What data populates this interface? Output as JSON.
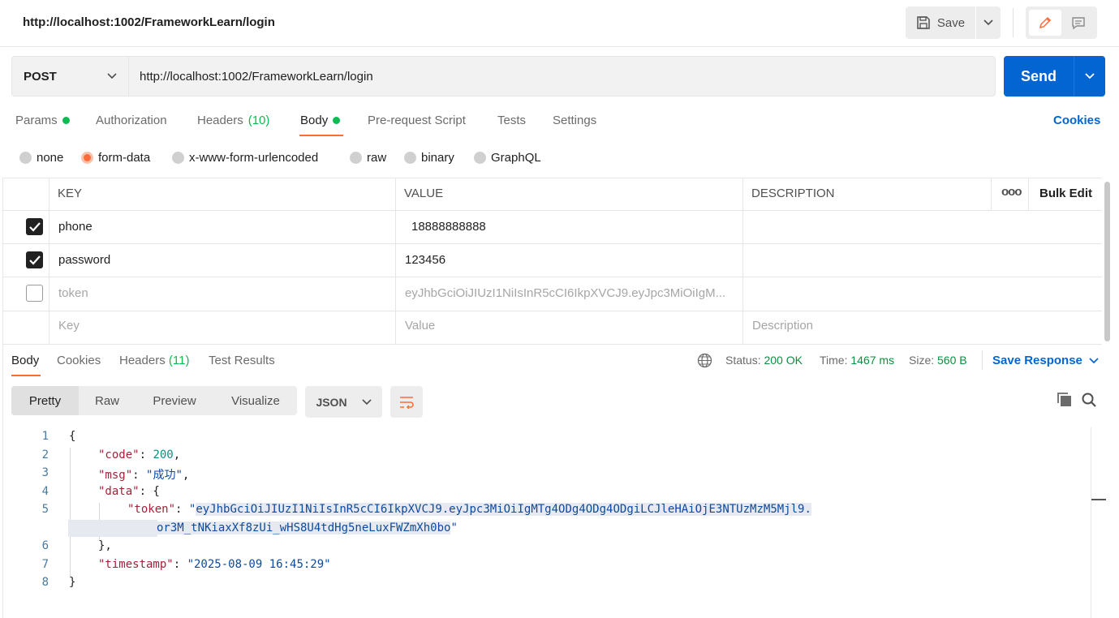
{
  "header": {
    "title": "http://localhost:1002/FrameworkLearn/login",
    "save_label": "Save"
  },
  "request": {
    "method": "POST",
    "url": "http://localhost:1002/FrameworkLearn/login",
    "send_label": "Send",
    "tabs": [
      {
        "label": "Params",
        "dot": true
      },
      {
        "label": "Authorization"
      },
      {
        "label": "Headers",
        "count": "(10)"
      },
      {
        "label": "Body",
        "dot": true,
        "active": true
      },
      {
        "label": "Pre-request Script"
      },
      {
        "label": "Tests"
      },
      {
        "label": "Settings"
      }
    ],
    "cookies_label": "Cookies"
  },
  "body_types": [
    "none",
    "form-data",
    "x-www-form-urlencoded",
    "raw",
    "binary",
    "GraphQL"
  ],
  "body_type_selected": "form-data",
  "table": {
    "headers": {
      "key": "KEY",
      "value": "VALUE",
      "description": "DESCRIPTION",
      "more": "ooo",
      "bulk_edit": "Bulk Edit"
    },
    "rows": [
      {
        "checked": true,
        "key": "phone",
        "value": "18888888888"
      },
      {
        "checked": true,
        "key": "password",
        "value": "123456"
      },
      {
        "checked": false,
        "key": "token",
        "value": "eyJhbGciOiJIUzI1NiIsInR5cCI6IkpXVCJ9.eyJpc3MiOiIgM..."
      }
    ],
    "placeholders": {
      "key": "Key",
      "value": "Value",
      "description": "Description"
    }
  },
  "response": {
    "tabs": [
      {
        "label": "Body",
        "active": true
      },
      {
        "label": "Cookies"
      },
      {
        "label": "Headers",
        "count": "(11)"
      },
      {
        "label": "Test Results"
      }
    ],
    "status_label": "Status:",
    "status_value": "200 OK",
    "time_label": "Time:",
    "time_value": "1467 ms",
    "size_label": "Size:",
    "size_value": "560 B",
    "save_response_label": "Save Response",
    "view_modes": [
      "Pretty",
      "Raw",
      "Preview",
      "Visualize"
    ],
    "language": "JSON"
  },
  "code": {
    "line_numbers": [
      "1",
      "2",
      "3",
      "4",
      "5",
      "6",
      "7",
      "8"
    ],
    "code_value": "200",
    "msg_value": "\"成功\"",
    "token_part1": "eyJhbGciOiJIUzI1NiIsInR5cCI6IkpXVCJ9.eyJpc3MiOiIgMTg4ODg4ODg4ODgiLCJleHAiOjE3NTUzMzM5Mjl9.",
    "token_part2": "or3M_tNKiaxXf8zUi_wHS8U4tdHg5neLuxFWZmXh0bo",
    "timestamp_value": "\"2025-08-09 16:45:29\""
  }
}
